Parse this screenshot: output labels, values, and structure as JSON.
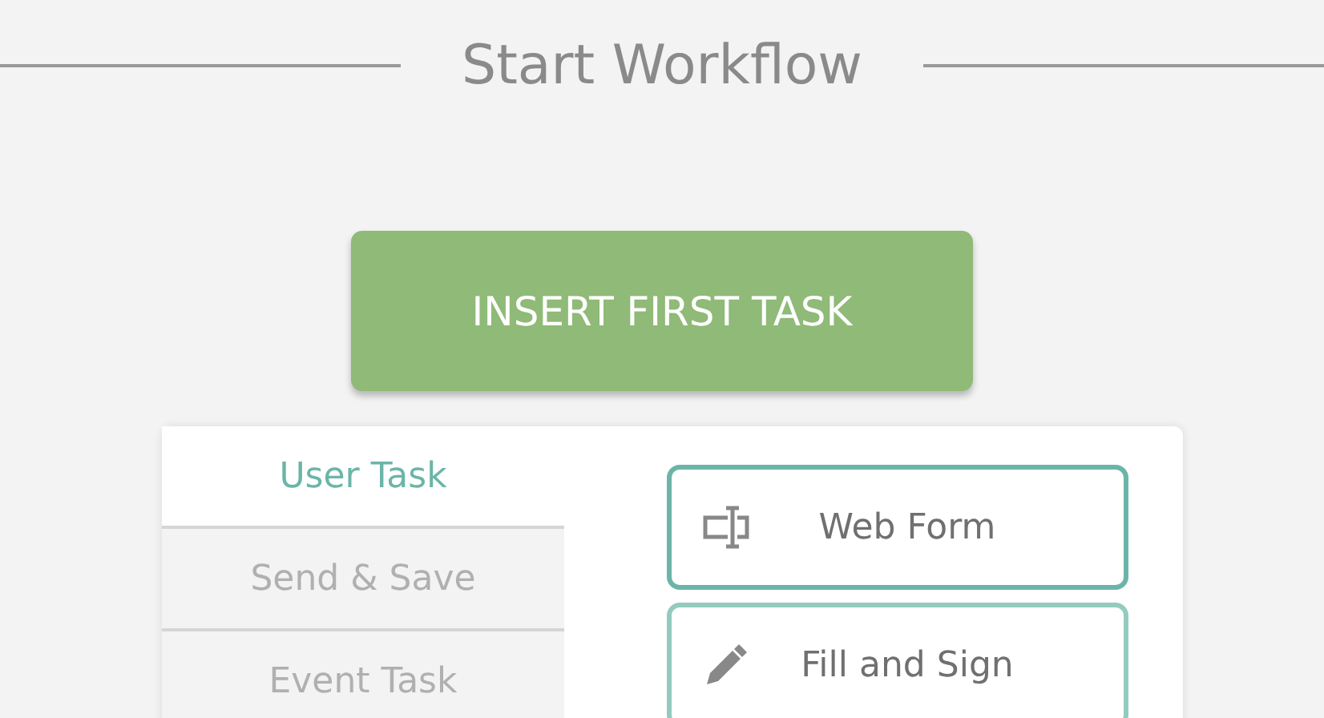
{
  "header": {
    "title": "Start Workflow"
  },
  "insert_button": {
    "label": "INSERT FIRST TASK"
  },
  "task_tabs": [
    {
      "label": "User Task",
      "selected": true
    },
    {
      "label": "Send & Save",
      "selected": false
    },
    {
      "label": "Event Task",
      "selected": false
    }
  ],
  "task_options": [
    {
      "label": "Web Form",
      "kind": "form",
      "selected": true
    },
    {
      "label": "Fill and Sign",
      "kind": "pen",
      "selected": false
    }
  ]
}
